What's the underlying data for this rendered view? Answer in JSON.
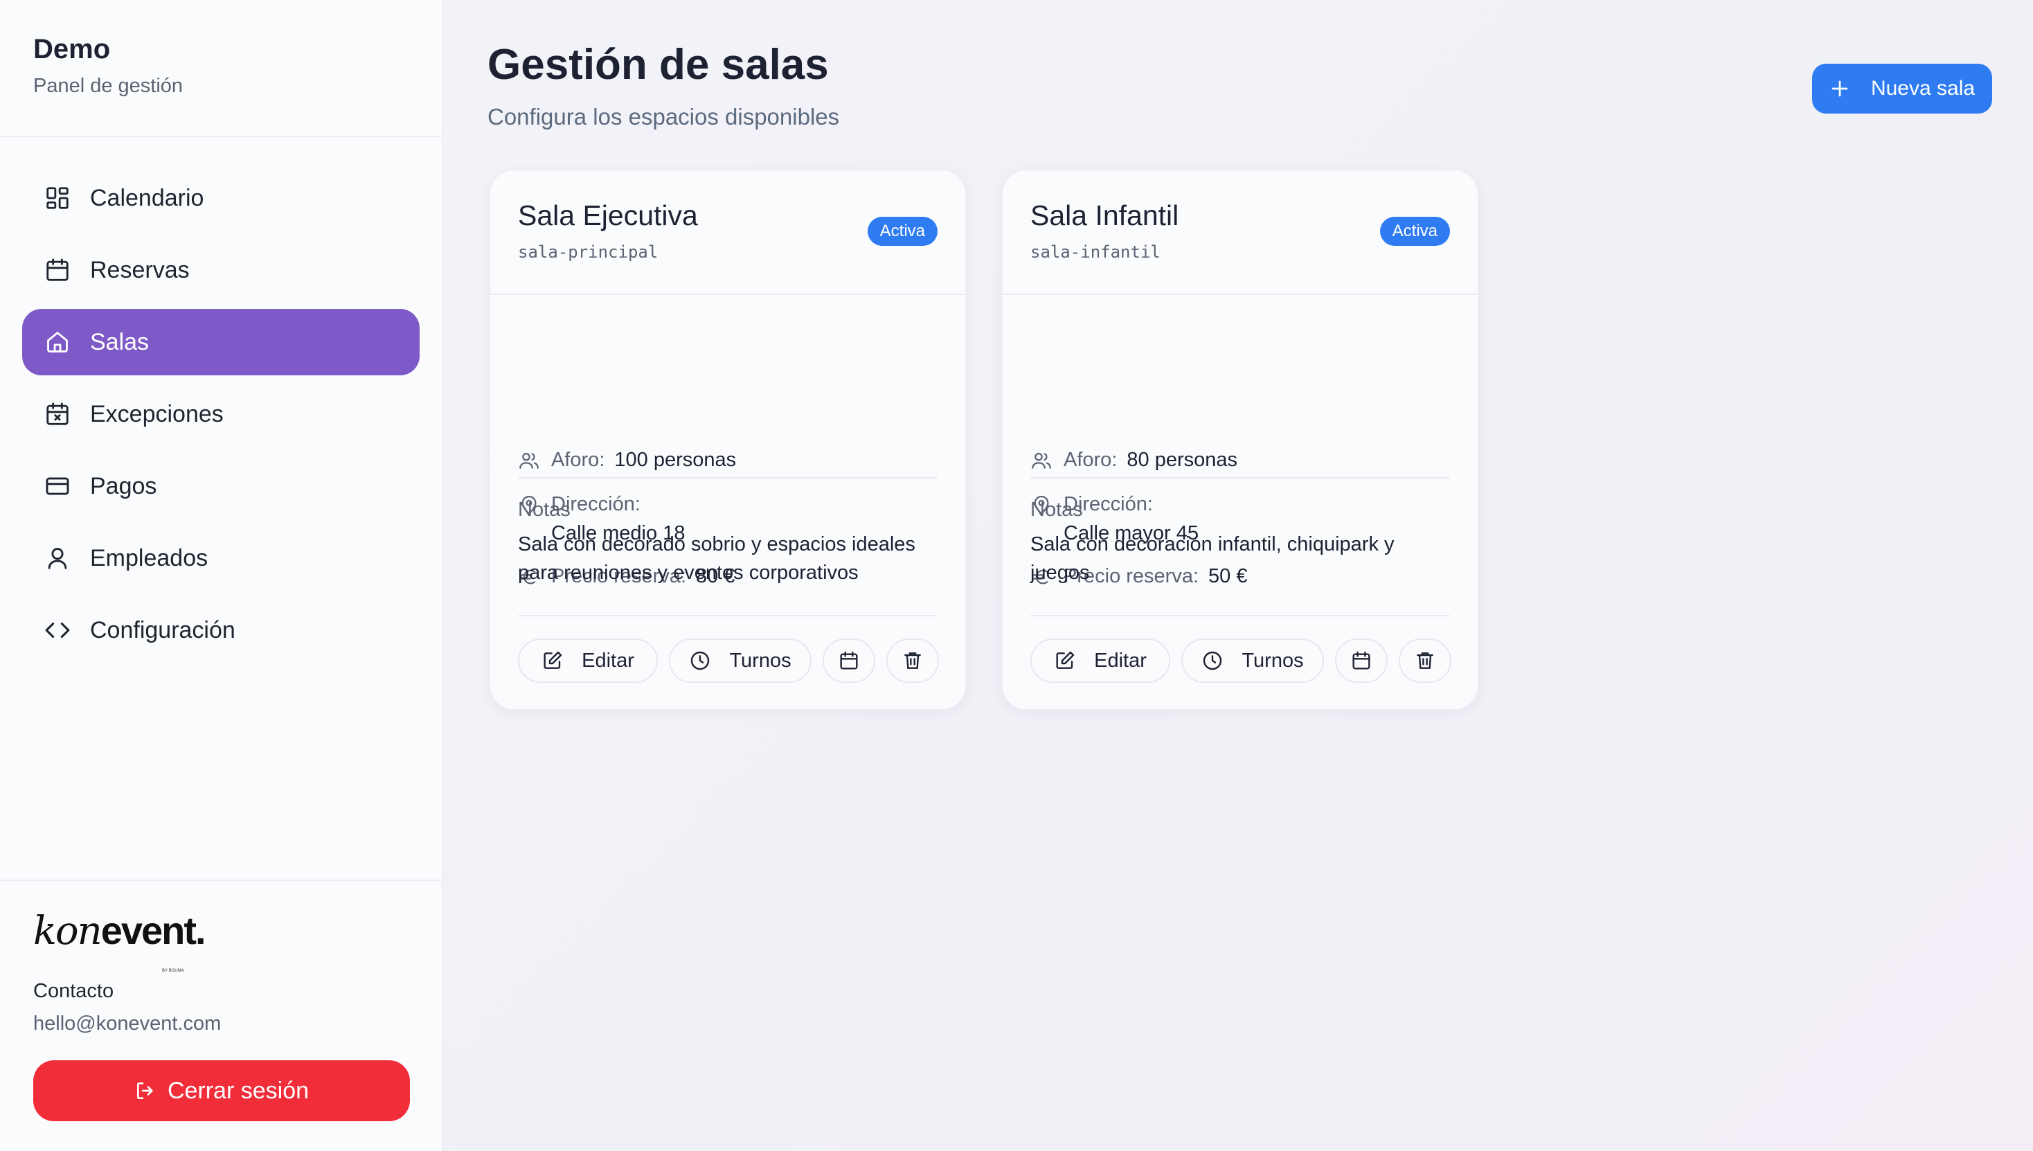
{
  "sidebar": {
    "brand_title": "Demo",
    "brand_subtitle": "Panel de gestión",
    "items": [
      {
        "label": "Calendario",
        "icon": "dashboard-grid-icon",
        "active": false
      },
      {
        "label": "Reservas",
        "icon": "calendar-icon",
        "active": false
      },
      {
        "label": "Salas",
        "icon": "home-icon",
        "active": true
      },
      {
        "label": "Excepciones",
        "icon": "calendar-x-icon",
        "active": false
      },
      {
        "label": "Pagos",
        "icon": "credit-card-icon",
        "active": false
      },
      {
        "label": "Empleados",
        "icon": "user-icon",
        "active": false
      },
      {
        "label": "Configuración",
        "icon": "code-icon",
        "active": false
      }
    ],
    "logo": {
      "kon": "kon",
      "event": "event.",
      "tagline": "BY BOUMA"
    },
    "contact_label": "Contacto",
    "contact_email": "hello@konevent.com",
    "logout_label": "Cerrar sesión"
  },
  "main": {
    "title": "Gestión de salas",
    "subtitle": "Configura los espacios disponibles",
    "new_button": "Nueva sala",
    "cards": [
      {
        "title": "Sala Ejecutiva",
        "slug": "sala-principal",
        "status": "Activa",
        "capacity_label": "Aforo:",
        "capacity_value": "100 personas",
        "address_label": "Dirección:",
        "address_value": "Calle medio 18",
        "price_label": "Precio reserva:",
        "price_value": "80 €",
        "notes_label": "Notas",
        "notes_text": "Sala con decorado sobrio y espacios ideales para reuniones y eventos corporativos",
        "edit_label": "Editar",
        "shifts_label": "Turnos"
      },
      {
        "title": "Sala Infantil",
        "slug": "sala-infantil",
        "status": "Activa",
        "capacity_label": "Aforo:",
        "capacity_value": "80 personas",
        "address_label": "Dirección:",
        "address_value": "Calle mayor 45",
        "price_label": "Precio reserva:",
        "price_value": "50 €",
        "notes_label": "Notas",
        "notes_text": "Sala con decoración infantil, chiquipark y juegos",
        "edit_label": "Editar",
        "shifts_label": "Turnos"
      }
    ]
  },
  "colors": {
    "accent_purple": "#7e5ac8",
    "primary_blue": "#2f7cf2",
    "danger_red": "#f22d3a"
  }
}
